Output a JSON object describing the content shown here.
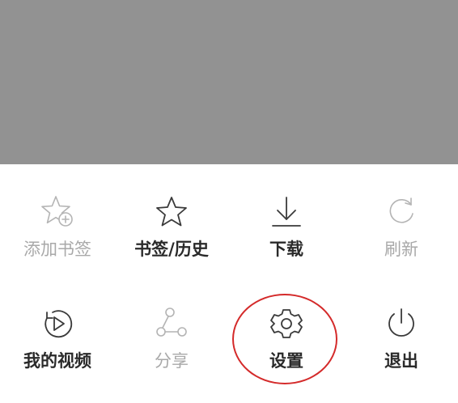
{
  "colors": {
    "overlay": "#929292",
    "sheet_background": "#ffffff",
    "enabled_text": "#2a2a2a",
    "disabled_text": "#a9a9a9",
    "enabled_icon": "#3a3a3a",
    "disabled_icon": "#b4b4b4",
    "highlight_ring": "#d42a2a"
  },
  "menu": {
    "rows": [
      [
        {
          "label": "添加书签",
          "icon": "add-bookmark-icon",
          "enabled": false
        },
        {
          "label": "书签/历史",
          "icon": "star-icon",
          "enabled": true
        },
        {
          "label": "下载",
          "icon": "download-icon",
          "enabled": true
        },
        {
          "label": "刷新",
          "icon": "refresh-icon",
          "enabled": false
        }
      ],
      [
        {
          "label": "我的视频",
          "icon": "video-play-icon",
          "enabled": true
        },
        {
          "label": "分享",
          "icon": "share-icon",
          "enabled": false
        },
        {
          "label": "设置",
          "icon": "settings-gear-icon",
          "enabled": true,
          "highlighted": true
        },
        {
          "label": "退出",
          "icon": "power-icon",
          "enabled": true
        }
      ]
    ]
  }
}
